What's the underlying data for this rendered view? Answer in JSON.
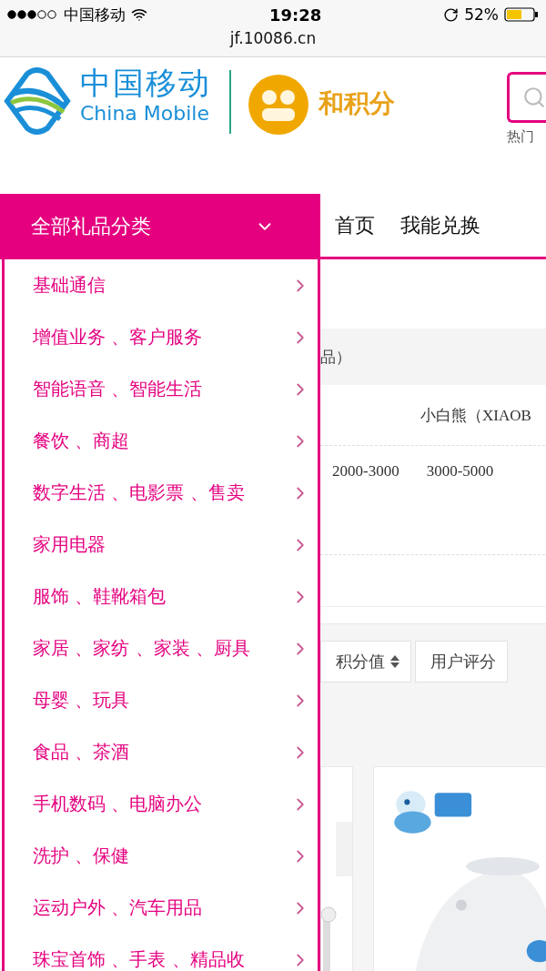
{
  "status_bar": {
    "carrier": "中国移动",
    "time": "19:28",
    "battery": "52%",
    "url": "jf.10086.cn"
  },
  "header": {
    "logo_cn": "中国移动",
    "logo_en": "China Mobile",
    "points_logo": "和积分",
    "search_hint": "热门"
  },
  "category_menu": {
    "title": "全部礼品分类",
    "expanded": true,
    "items": [
      "基础通信",
      "增值业务 、客户服务",
      "智能语音 、智能生活",
      "餐饮 、商超",
      "数字生活 、电影票 、售卖",
      "家用电器",
      "服饰 、鞋靴箱包",
      "家居 、家纺 、家装 、厨具",
      "母婴 、玩具",
      "食品 、茶酒",
      "手机数码 、电脑办公",
      "洗护 、保健",
      "运动户外 、汽车用品",
      "珠宝首饰 、手表 、精品收"
    ]
  },
  "nav": [
    "首页",
    "我能兑换"
  ],
  "content": {
    "filter_label": "品）",
    "brand": "小白熊（XIAOB",
    "ranges": [
      "2000-3000",
      "3000-5000"
    ],
    "sort_buttons": [
      {
        "label": "积分值",
        "kind": "sortable"
      },
      {
        "label": "用户评分",
        "kind": "plain"
      }
    ]
  }
}
